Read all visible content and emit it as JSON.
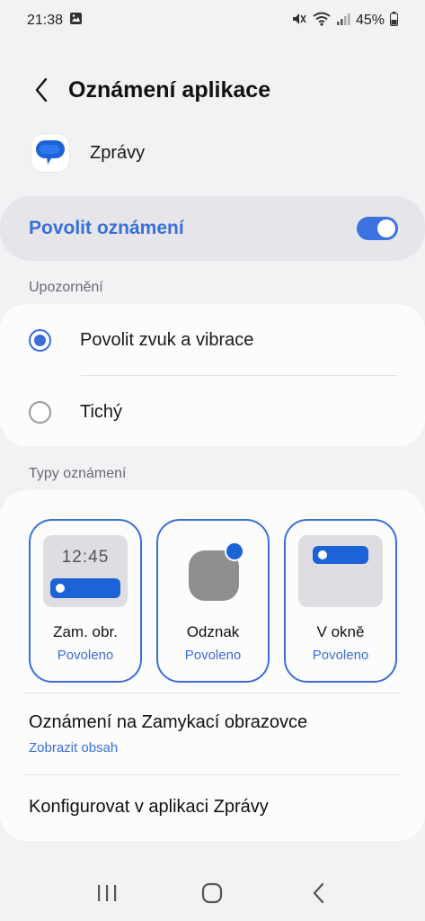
{
  "status_bar": {
    "time": "21:38",
    "battery": "45%",
    "icons": [
      "gallery-icon",
      "mute-icon",
      "wifi-icon",
      "signal-icon",
      "battery-icon"
    ]
  },
  "header": {
    "title": "Oznámení aplikace",
    "back_icon": "chevron-left-icon"
  },
  "app": {
    "name": "Zprávy",
    "icon": "messages-app-icon"
  },
  "allow": {
    "label": "Povolit oznámení",
    "enabled": true
  },
  "alerts_section": {
    "label": "Upozornění",
    "options": [
      {
        "label": "Povolit zvuk a vibrace",
        "selected": true
      },
      {
        "label": "Tichý",
        "selected": false
      }
    ]
  },
  "types_section": {
    "label": "Typy oznámení",
    "tiles": [
      {
        "title": "Zam. obr.",
        "status": "Povoleno",
        "preview_time": "12:45"
      },
      {
        "title": "Odznak",
        "status": "Povoleno"
      },
      {
        "title": "V okně",
        "status": "Povoleno"
      }
    ]
  },
  "lockscreen": {
    "title": "Oznámení na Zamykací obrazovce",
    "subtitle": "Zobrazit obsah"
  },
  "configure": {
    "title": "Konfigurovat v aplikaci Zprávy"
  },
  "colors": {
    "accent": "#3a6fd8",
    "background": "#f2f2f4",
    "card": "#fcfcfd"
  }
}
